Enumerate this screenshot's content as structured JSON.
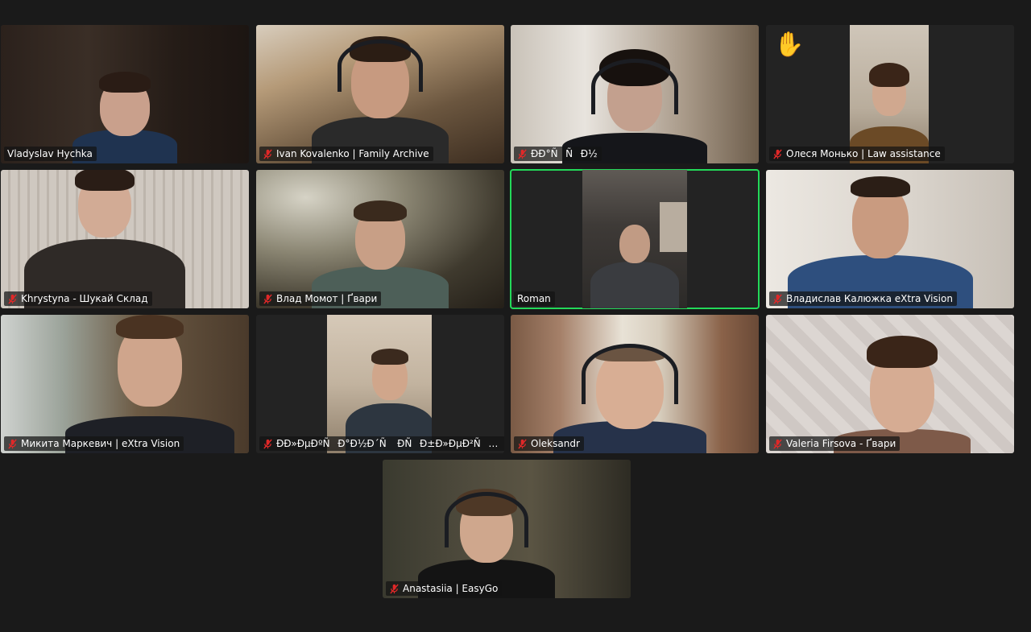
{
  "participants": [
    {
      "name": "Vladyslav Hychka",
      "muted": false
    },
    {
      "name": "Ivan Kovalenko | Family Archive",
      "muted": true
    },
    {
      "name": "ÐÐ°ÑÑÐ½",
      "muted": true
    },
    {
      "name": "Олеся Монько | Law assistance",
      "muted": true,
      "hand_raised": true,
      "hand_icon": "✋"
    },
    {
      "name": "Khrystyna - Шукай Склад",
      "muted": true
    },
    {
      "name": "Влад Момот | Ґвари",
      "muted": true
    },
    {
      "name": "Roman",
      "muted": false,
      "active_speaker": true
    },
    {
      "name": "Владислав Калюжка eXtra Vision",
      "muted": true
    },
    {
      "name": "Микита Маркевич | eXtra Vision",
      "muted": true
    },
    {
      "name": "ÐÐ»ÐµÐºÑÐ°Ð½Ð´Ñ ÐÑÐ±Ð»ÐµÐ²ÑÐº...",
      "muted": true
    },
    {
      "name": "Oleksandr",
      "muted": true
    },
    {
      "name": "Valeria Firsova - Ґвари",
      "muted": true
    },
    {
      "name": "Anastasiia | EasyGo",
      "muted": true
    }
  ],
  "colors": {
    "background": "#1a1a1a",
    "tile": "#232323",
    "active_speaker_border": "#23d959",
    "muted_icon": "#e02828",
    "label_bg": "rgba(20,20,20,0.72)"
  }
}
